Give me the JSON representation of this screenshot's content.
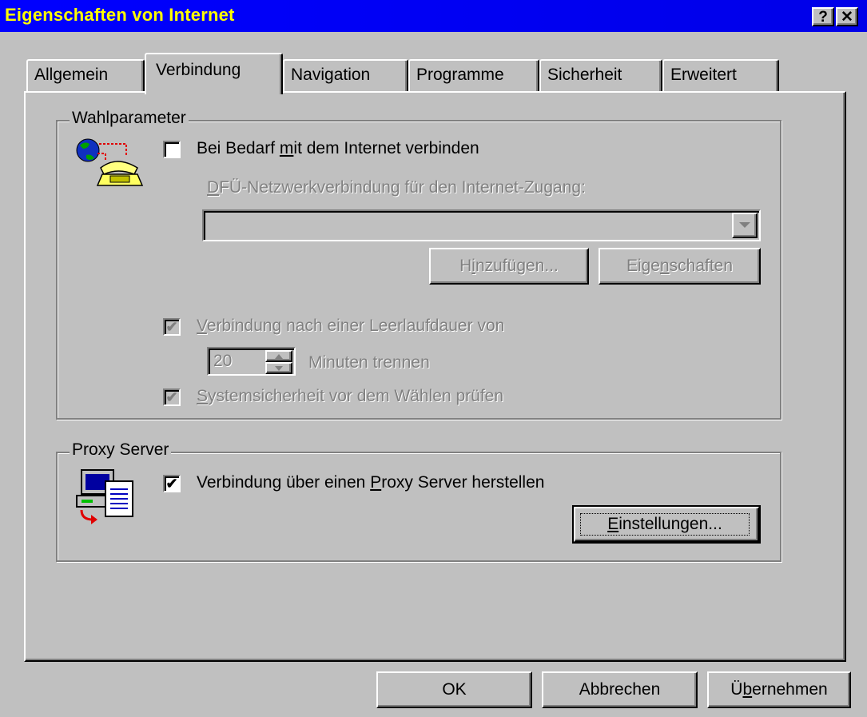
{
  "window": {
    "title": "Eigenschaften von Internet",
    "help_label": "?",
    "close_label": "✕"
  },
  "tabs": [
    {
      "label": "Allgemein",
      "active": false
    },
    {
      "label": "Verbindung",
      "active": true
    },
    {
      "label": "Navigation",
      "active": false
    },
    {
      "label": "Programme",
      "active": false
    },
    {
      "label": "Sicherheit",
      "active": false
    },
    {
      "label": "Erweitert",
      "active": false
    }
  ],
  "dial": {
    "legend": "Wahlparameter",
    "auto_connect": {
      "pre": "Bei Bedarf ",
      "u": "m",
      "post": "it dem Internet verbinden",
      "checked": false
    },
    "dun_label": {
      "pre": "",
      "u": "D",
      "post": "FÜ-Netzwerkverbindung für den Internet-Zugang:"
    },
    "dun_value": "",
    "add_button": {
      "pre": "H",
      "u": "i",
      "post": "nzufügen..."
    },
    "properties_button": {
      "pre": "Eige",
      "u": "n",
      "post": "schaften"
    },
    "idle_disconnect": {
      "pre": "",
      "u": "V",
      "post": "erbindung nach einer Leerlaufdauer von",
      "checked": true
    },
    "minutes_value": "20",
    "minutes_label": "Minuten trennen",
    "security_check": {
      "pre": "",
      "u": "S",
      "post": "ystemsicherheit vor dem Wählen prüfen",
      "checked": true
    }
  },
  "proxy": {
    "legend": "Proxy Server",
    "use_proxy": {
      "pre": "Verbindung über einen ",
      "u": "P",
      "post": "roxy Server herstellen",
      "checked": true
    },
    "settings_button": {
      "pre": "",
      "u": "E",
      "post": "instellungen..."
    }
  },
  "footer": {
    "ok": "OK",
    "cancel": "Abbrechen",
    "apply": {
      "pre": "Ü",
      "u": "b",
      "post": "ernehmen"
    }
  },
  "check_glyph": "✔",
  "icons": [
    "globe-phone-icon",
    "proxy-computer-icon",
    "help-icon",
    "close-icon",
    "dropdown-arrow-icon",
    "spin-up-icon",
    "spin-down-icon"
  ]
}
